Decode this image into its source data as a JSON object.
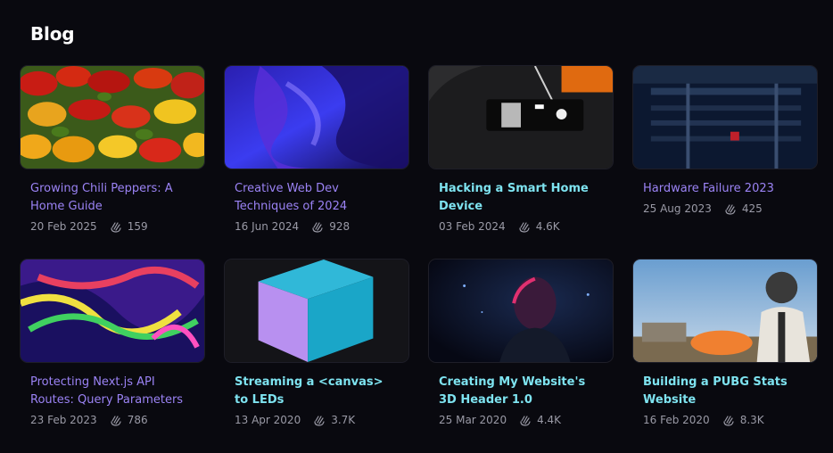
{
  "page": {
    "title": "Blog"
  },
  "posts": [
    {
      "title": "Growing Chili Peppers: A Home Guide",
      "date": "20 Feb 2025",
      "claps": "159",
      "title_color": "purple",
      "thumb": "chili-peppers-image"
    },
    {
      "title": "Creative Web Dev Techniques of 2024",
      "date": "16 Jun 2024",
      "claps": "928",
      "title_color": "purple",
      "thumb": "abstract-waves-image"
    },
    {
      "title": "Hacking a Smart Home Device",
      "date": "03 Feb 2024",
      "claps": "4.6K",
      "title_color": "cyan",
      "thumb": "circuit-board-image"
    },
    {
      "title": "Hardware Failure 2023",
      "date": "25 Aug 2023",
      "claps": "425",
      "title_color": "purple",
      "thumb": "server-rack-image"
    },
    {
      "title": "Protecting Next.js API Routes: Query Parameters",
      "date": "23 Feb 2023",
      "claps": "786",
      "title_color": "purple",
      "thumb": "neon-swirl-image"
    },
    {
      "title": "Streaming a <canvas> to LEDs",
      "date": "13 Apr 2020",
      "claps": "3.7K",
      "title_color": "cyan",
      "thumb": "led-cube-image"
    },
    {
      "title": "Creating My Website's 3D Header 1.0",
      "date": "25 Mar 2020",
      "claps": "4.4K",
      "title_color": "cyan",
      "thumb": "portrait-neon-image"
    },
    {
      "title": "Building a PUBG Stats Website",
      "date": "16 Feb 2020",
      "claps": "8.3K",
      "title_color": "cyan",
      "thumb": "pubg-soldier-image"
    }
  ],
  "colors": {
    "background": "#09090f",
    "purple_link": "#9b83f5",
    "cyan_link": "#7ee3f0",
    "meta_text": "#9a9aa6"
  },
  "icons": {
    "claps": "clap-hands-icon"
  }
}
